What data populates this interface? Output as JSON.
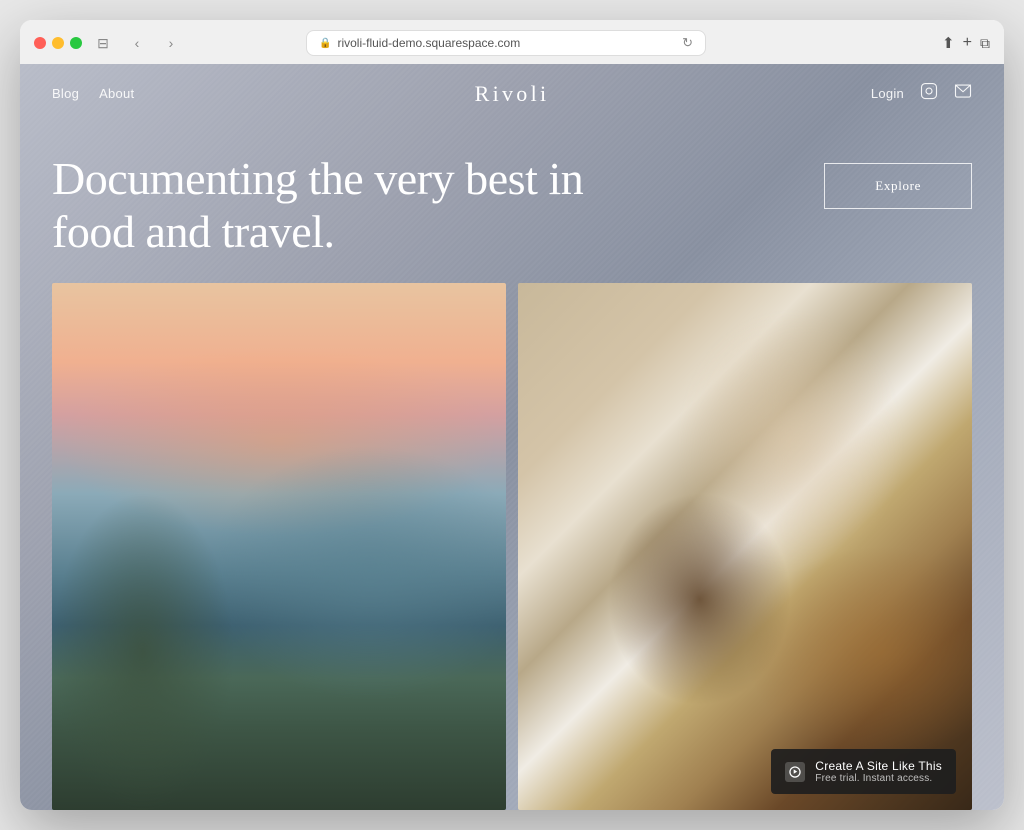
{
  "browser": {
    "url": "rivoli-fluid-demo.squarespace.com",
    "reload_icon": "↻",
    "back_icon": "‹",
    "forward_icon": "›",
    "share_icon": "⬆",
    "new_tab_icon": "+",
    "windows_icon": "⧉",
    "sidebar_icon": "⊟"
  },
  "nav": {
    "blog_label": "Blog",
    "about_label": "About",
    "brand": "Rivoli",
    "login_label": "Login"
  },
  "hero": {
    "headline_line1": "Documenting the very best in",
    "headline_line2": "food and travel.",
    "explore_button": "Explore"
  },
  "badge": {
    "title": "Create A Site Like This",
    "subtitle": "Free trial. Instant access.",
    "logo_char": "◈"
  }
}
